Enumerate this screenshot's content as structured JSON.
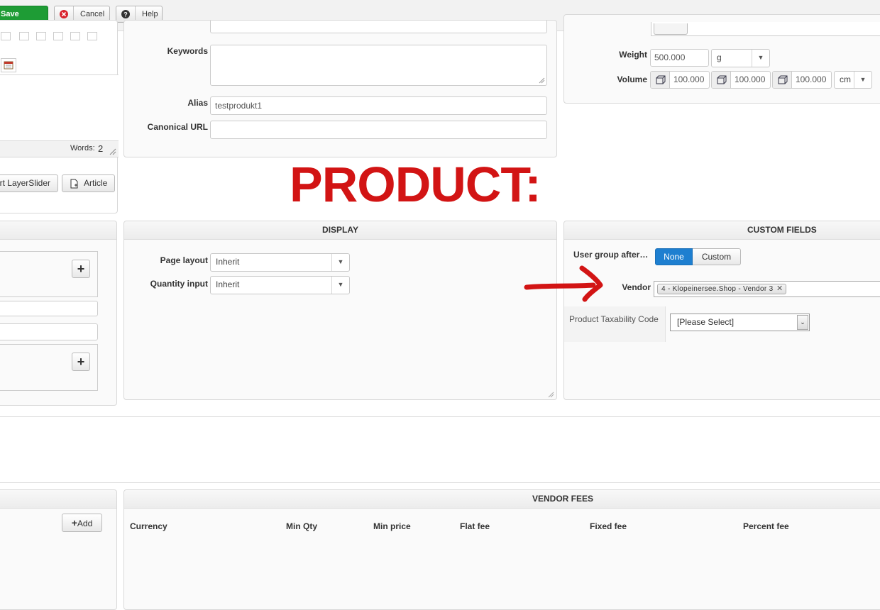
{
  "toolbar": {
    "save": "Save",
    "cancel": "Cancel",
    "help": "Help"
  },
  "editor": {
    "words_label": "Words:",
    "words_count": "2",
    "layerslider_button": "rt LayerSlider",
    "article_button": "Article"
  },
  "meta": {
    "keywords_label": "Keywords",
    "keywords_value": "",
    "alias_label": "Alias",
    "alias_value": "testprodukt1",
    "canonical_label": "Canonical URL",
    "canonical_value": ""
  },
  "shipping": {
    "weight_label": "Weight",
    "weight_value": "500.000",
    "weight_unit": "g",
    "volume_label": "Volume",
    "volume_values": [
      "100.000",
      "100.000",
      "100.000"
    ],
    "volume_unit": "cm"
  },
  "annotation": {
    "text": "PRODUCT:",
    "color": "#d21414"
  },
  "display": {
    "title": "DISPLAY",
    "page_layout_label": "Page layout",
    "page_layout_value": "Inherit",
    "quantity_label": "Quantity input",
    "quantity_value": "Inherit"
  },
  "custom_fields": {
    "title": "CUSTOM FIELDS",
    "user_group_label": "User group after…",
    "user_group_options": [
      "None",
      "Custom"
    ],
    "user_group_selected": "None",
    "vendor_label": "Vendor",
    "vendor_tag": "4 - Klopeinersee.Shop - Vendor 3",
    "taxability_label": "Product Taxability Code",
    "taxability_value": "[Please Select]"
  },
  "vendor_fees": {
    "title": "VENDOR FEES",
    "add_button": "Add",
    "columns": [
      "Currency",
      "Min Qty",
      "Min price",
      "Flat fee",
      "Fixed fee",
      "Percent fee"
    ]
  },
  "colors": {
    "save_green": "#1e9c35",
    "active_blue": "#1e7fd0",
    "annotation_red": "#d21414"
  }
}
